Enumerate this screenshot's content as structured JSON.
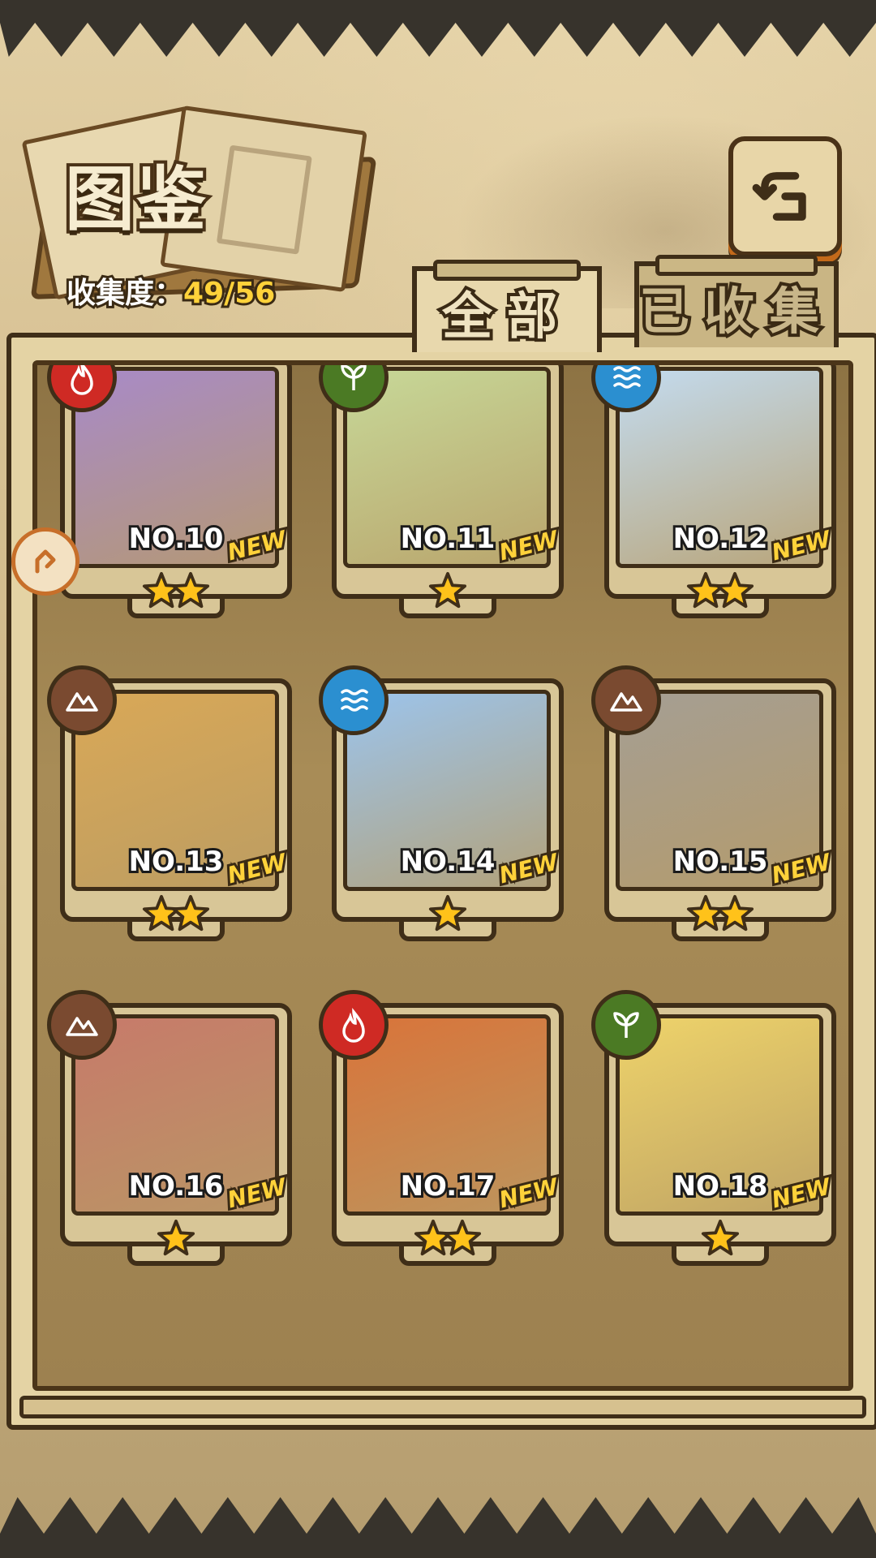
{
  "header": {
    "title": "图鉴",
    "collection_label": "收集度：",
    "collection_value": "49/56"
  },
  "tabs": [
    {
      "label": "全部",
      "active": true
    },
    {
      "label": "已收集",
      "active": false
    }
  ],
  "colors": {
    "fire": "#cf2a24",
    "wood": "#4b7a24",
    "water": "#2b8fd0",
    "earth": "#7a4a30",
    "star": "#ffc21a",
    "new_badge": "#ffd23a"
  },
  "cards": [
    {
      "number": "NO.10",
      "element": "fire",
      "stars": 2,
      "badge": "NEW",
      "art": "#a88ac8"
    },
    {
      "number": "NO.11",
      "element": "wood",
      "stars": 1,
      "badge": "NEW",
      "art": "#c7d898"
    },
    {
      "number": "NO.12",
      "element": "water",
      "stars": 2,
      "badge": "NEW",
      "art": "#c3dbef"
    },
    {
      "number": "NO.13",
      "element": "earth",
      "stars": 2,
      "badge": "NEW",
      "art": "#d9a857"
    },
    {
      "number": "NO.14",
      "element": "water",
      "stars": 1,
      "badge": "NEW",
      "art": "#9cc4ec"
    },
    {
      "number": "NO.15",
      "element": "earth",
      "stars": 2,
      "badge": "NEW",
      "art": "#a59e93"
    },
    {
      "number": "NO.16",
      "element": "earth",
      "stars": 1,
      "badge": "NEW",
      "art": "#c77a6a"
    },
    {
      "number": "NO.17",
      "element": "fire",
      "stars": 2,
      "badge": "NEW",
      "art": "#d9743a"
    },
    {
      "number": "NO.18",
      "element": "wood",
      "stars": 1,
      "badge": "NEW",
      "art": "#eed36a"
    }
  ]
}
